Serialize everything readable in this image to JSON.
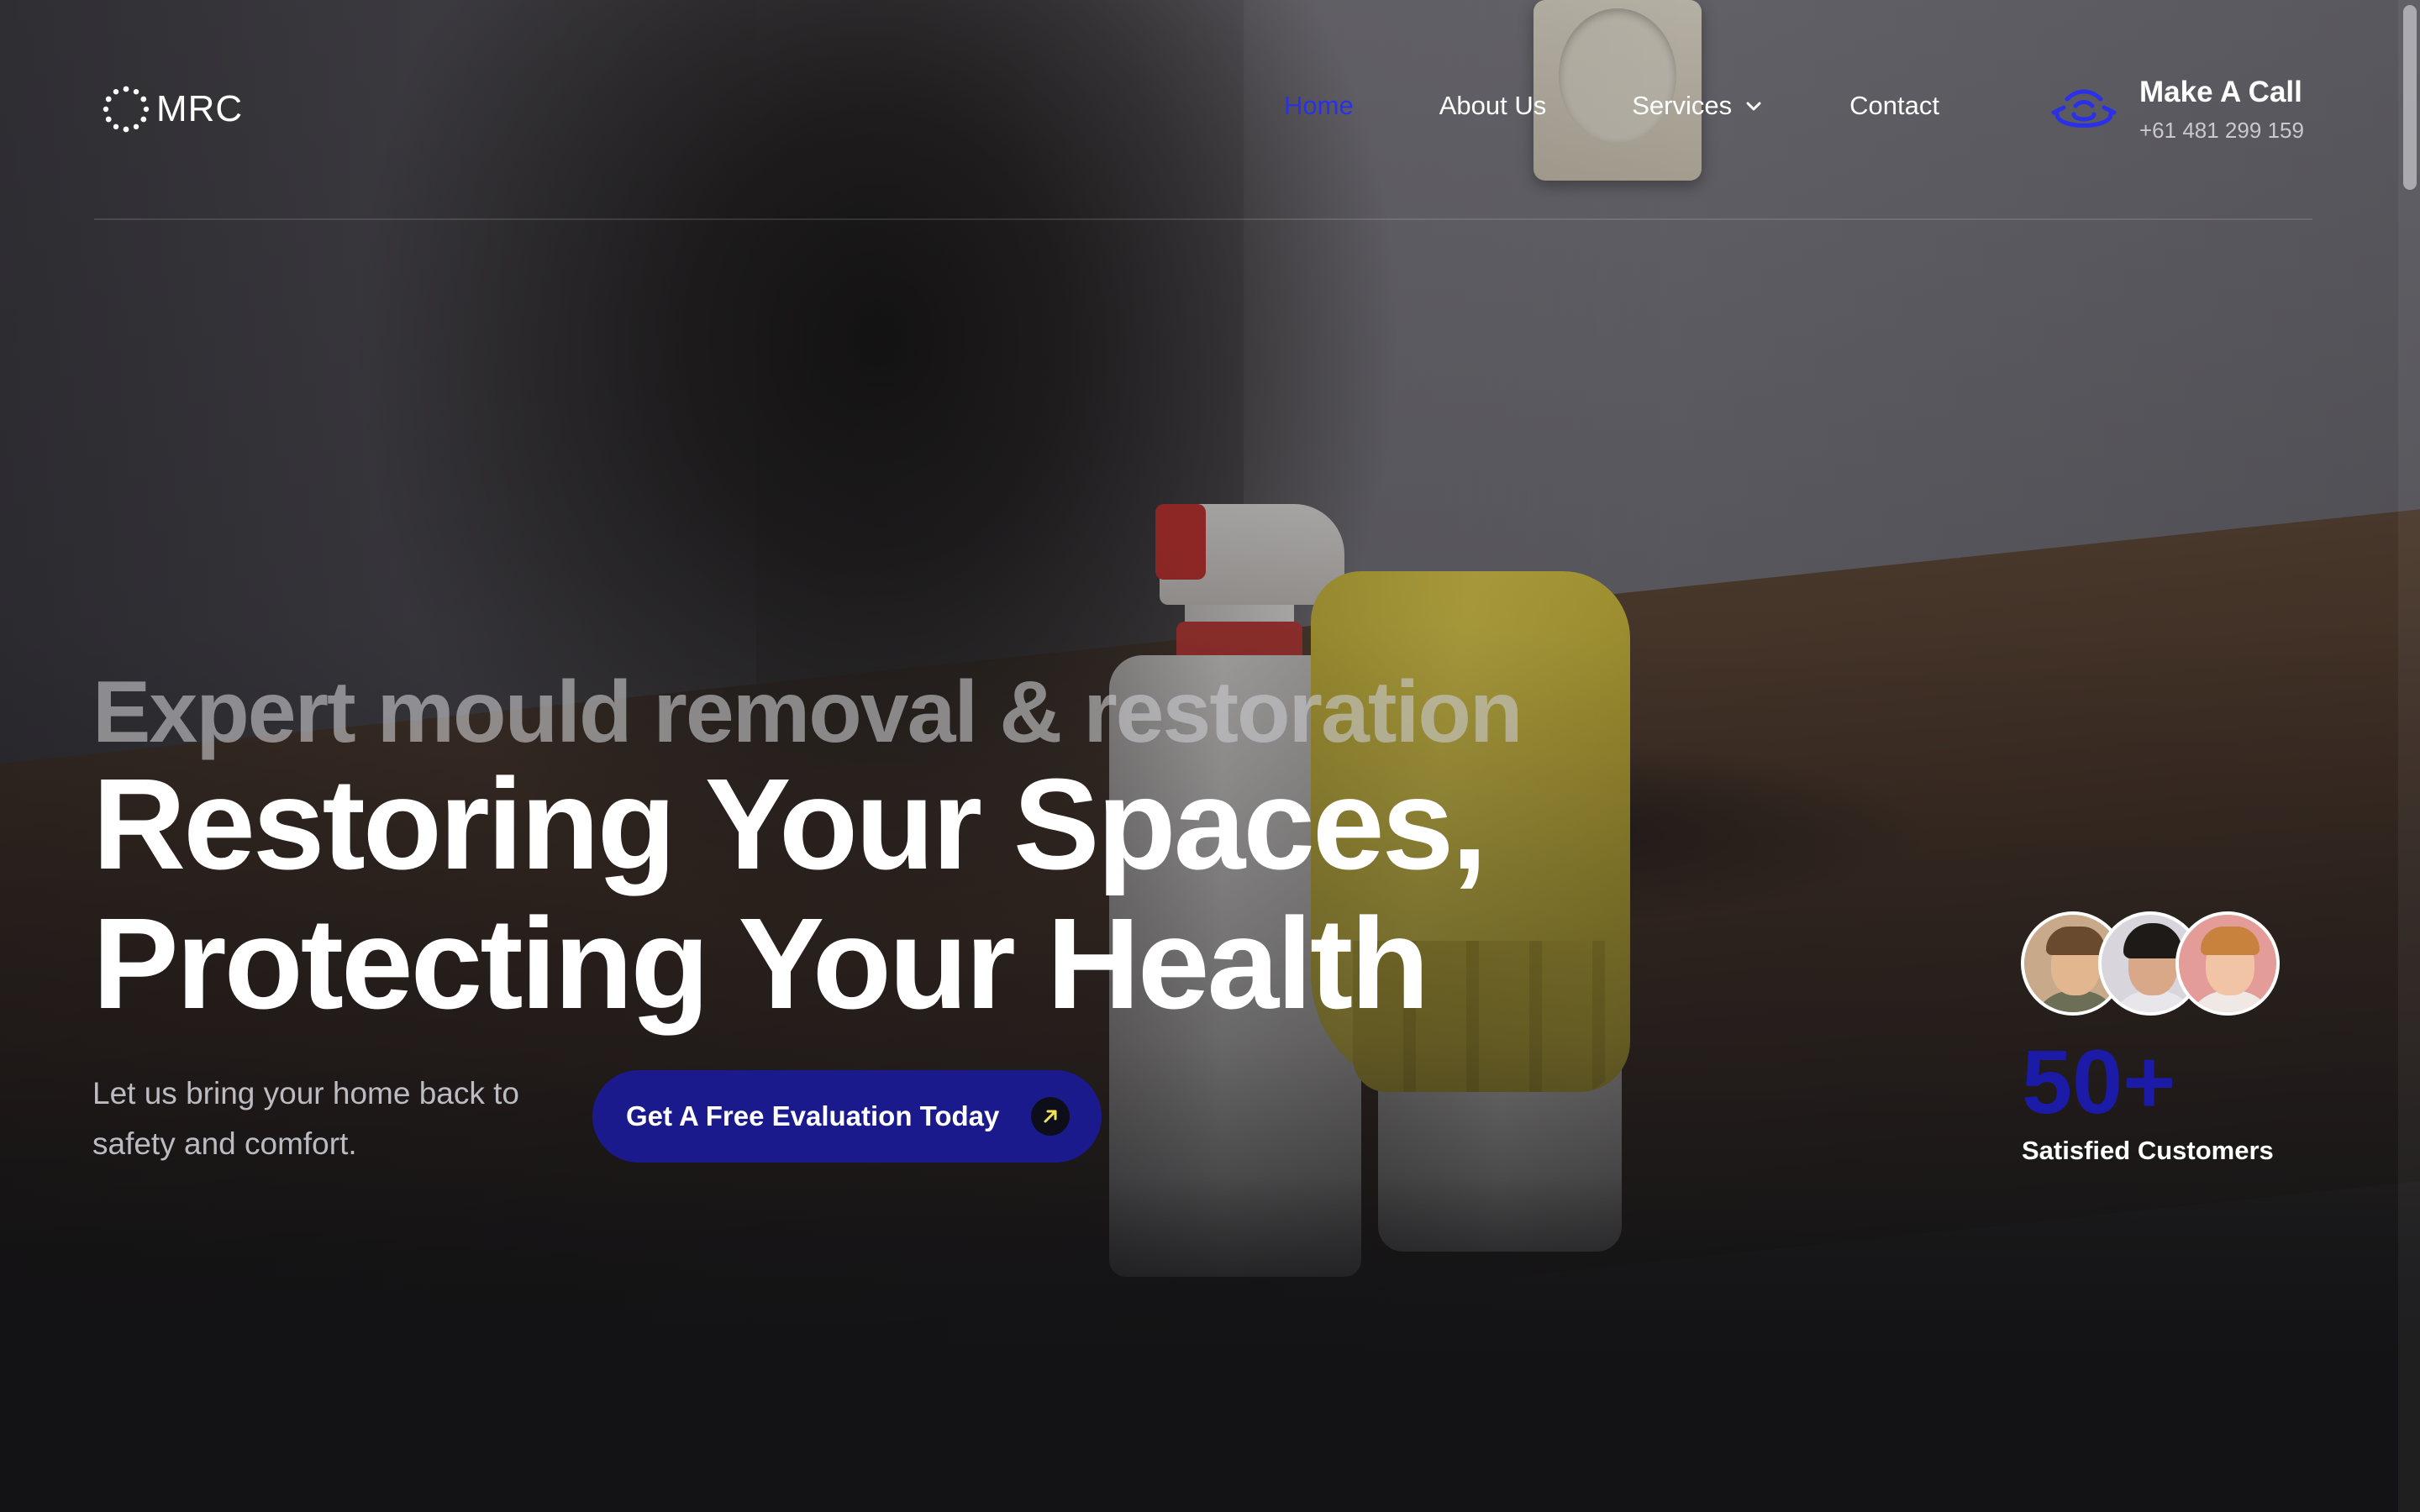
{
  "brand": {
    "name": "MRC"
  },
  "nav": {
    "items": [
      {
        "label": "Home",
        "active": true
      },
      {
        "label": "About Us",
        "active": false
      },
      {
        "label": "Services",
        "active": false,
        "has_dropdown": true
      },
      {
        "label": "Contact",
        "active": false
      }
    ]
  },
  "call": {
    "title": "Make A Call",
    "phone": "+61 481 299 159",
    "icon": "headset-icon"
  },
  "hero": {
    "eyebrow": "Expert mould removal & restoration",
    "headline_line1": "Restoring Your Spaces,",
    "headline_line2": "Protecting Your Health",
    "subtext": "Let us bring your home back to safety and comfort.",
    "cta_label": "Get A Free Evaluation Today",
    "cta_icon": "arrow-up-right-icon"
  },
  "customers": {
    "count": "50+",
    "label": "Satisfied Customers"
  },
  "colors": {
    "accent": "#2a30e8",
    "cta_background": "#1a1a8c",
    "stat_color": "#1b1ba8",
    "page_background": "#131315",
    "arrow_color": "#f2e25a"
  }
}
